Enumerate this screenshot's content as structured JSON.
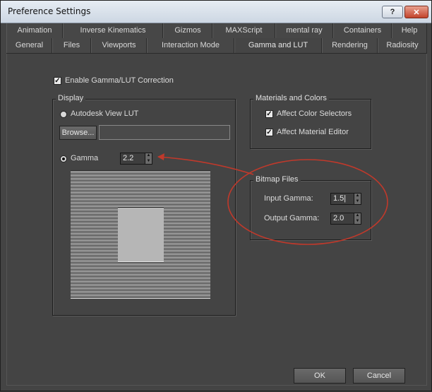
{
  "window": {
    "title": "Preference Settings",
    "help_label": "?",
    "close_label": "✕"
  },
  "tabs_row1": [
    "Animation",
    "Inverse Kinematics",
    "Gizmos",
    "MAXScript",
    "mental ray",
    "Containers",
    "Help"
  ],
  "tabs_row2": [
    "General",
    "Files",
    "Viewports",
    "Interaction Mode",
    "Gamma and LUT",
    "Rendering",
    "Radiosity"
  ],
  "active_tab": "Gamma and LUT",
  "enable": {
    "label": "Enable Gamma/LUT Correction",
    "checked": true
  },
  "display": {
    "title": "Display",
    "lut_label": "Autodesk View LUT",
    "browse_label": "Browse...",
    "path_value": "",
    "gamma_label": "Gamma",
    "gamma_value": "2.2"
  },
  "materials": {
    "title": "Materials and Colors",
    "color_selectors": "Affect Color Selectors",
    "material_editor": "Affect Material Editor"
  },
  "bitmap": {
    "title": "Bitmap Files",
    "input_label": "Input Gamma:",
    "input_value": "1.5|",
    "output_label": "Output Gamma:",
    "output_value": "2.0"
  },
  "footer": {
    "ok_label": "OK",
    "cancel_label": "Cancel"
  },
  "colors": {
    "annotation": "#c0392b",
    "window_bg": "#444444"
  }
}
